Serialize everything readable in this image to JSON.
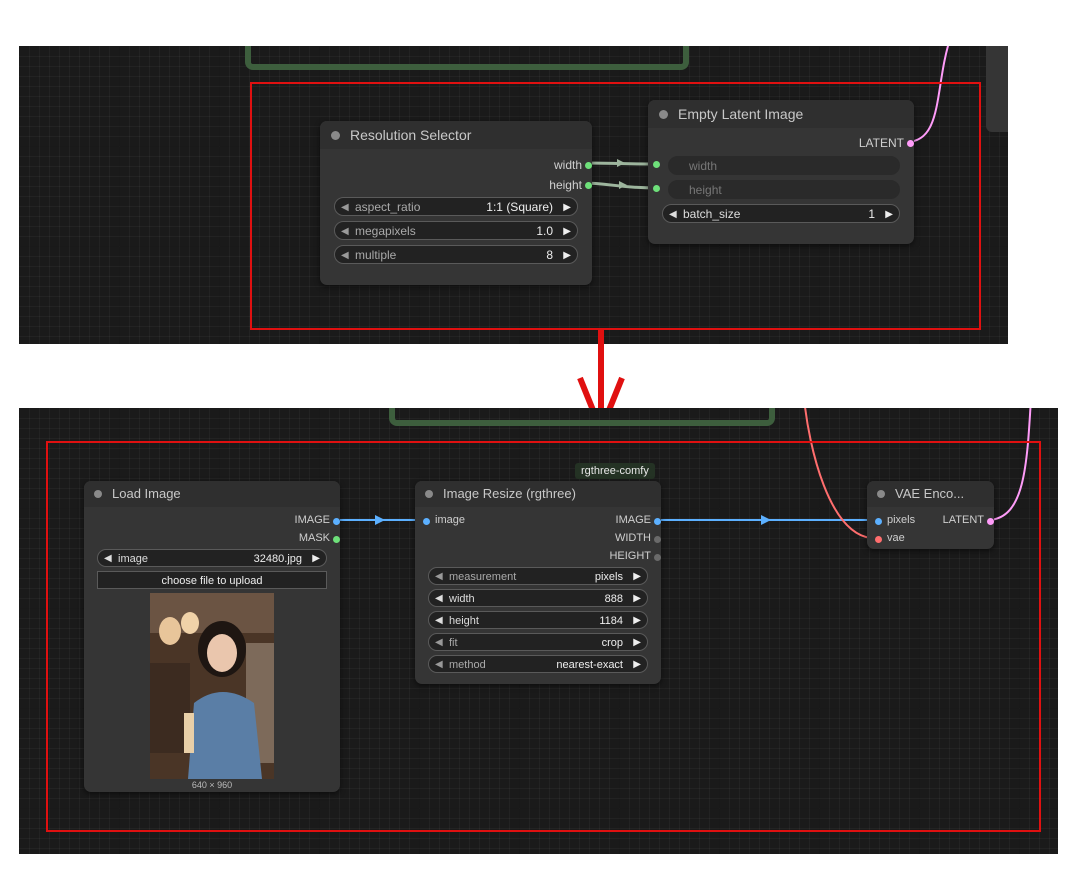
{
  "colors": {
    "canvas": "#1a1a1a",
    "node_bg": "#353535",
    "highlight_box": "#e01010",
    "arrow": "#e01010",
    "int_slot": "#6ee07a",
    "image_slot": "#5cb0ff",
    "latent_slot": "#ff9cf9",
    "vae_slot": "#ff6e6e",
    "group_border": "#3d5e3d",
    "mask_slot": "#6ee07a"
  },
  "top": {
    "resolution_selector": {
      "title": "Resolution Selector",
      "outputs": [
        "width",
        "height"
      ],
      "widgets": [
        {
          "name": "aspect_ratio",
          "value": "1:1 (Square)"
        },
        {
          "name": "megapixels",
          "value": "1.0"
        },
        {
          "name": "multiple",
          "value": "8"
        }
      ]
    },
    "empty_latent": {
      "title": "Empty Latent Image",
      "output": "LATENT",
      "converted_inputs": [
        "width",
        "height"
      ],
      "widgets": [
        {
          "name": "batch_size",
          "value": "1"
        }
      ]
    }
  },
  "bottom": {
    "badge": "rgthree-comfy",
    "load_image": {
      "title": "Load Image",
      "outputs": [
        "IMAGE",
        "MASK"
      ],
      "widget": {
        "name": "image",
        "value": "32480.jpg"
      },
      "upload_label": "choose file to upload",
      "preview_caption": "640 × 960"
    },
    "image_resize": {
      "title": "Image Resize (rgthree)",
      "input": "image",
      "outputs": [
        "IMAGE",
        "WIDTH",
        "HEIGHT"
      ],
      "widgets": [
        {
          "name": "measurement",
          "value": "pixels"
        },
        {
          "name": "width",
          "value": "888"
        },
        {
          "name": "height",
          "value": "1184"
        },
        {
          "name": "fit",
          "value": "crop"
        },
        {
          "name": "method",
          "value": "nearest-exact"
        }
      ]
    },
    "vae_encode": {
      "title": "VAE Enco...",
      "inputs": [
        "pixels",
        "vae"
      ],
      "output": "LATENT"
    }
  }
}
